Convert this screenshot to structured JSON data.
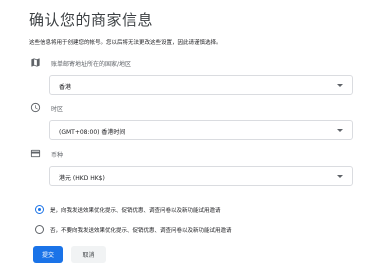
{
  "page": {
    "title": "确认您的商家信息",
    "description": "这些信息将用于创建您的帐号。您以后将无法更改这些设置，因此请谨慎选择。"
  },
  "fields": {
    "country": {
      "icon": "map-icon",
      "label": "账单邮寄地址所在的国家/地区",
      "value": "香港"
    },
    "timezone": {
      "icon": "clock-icon",
      "label": "时区",
      "value": "(GMT+08:00) 香港时间"
    },
    "currency": {
      "icon": "currency-icon",
      "label": "币种",
      "value": "港元 (HKD HK$)"
    }
  },
  "marketing": {
    "options": [
      {
        "label": "是，向我发送效果优化提示、促销优惠、调查问卷以及新功能试用邀请",
        "selected": true
      },
      {
        "label": "否，不要向我发送效果优化提示、促销优惠、调查问卷以及新功能试用邀请",
        "selected": false
      }
    ]
  },
  "actions": {
    "submit": "提交",
    "cancel": "取消"
  },
  "colors": {
    "accent": "#1a73e8",
    "icon": "#5f6368",
    "border": "#dadce0"
  }
}
